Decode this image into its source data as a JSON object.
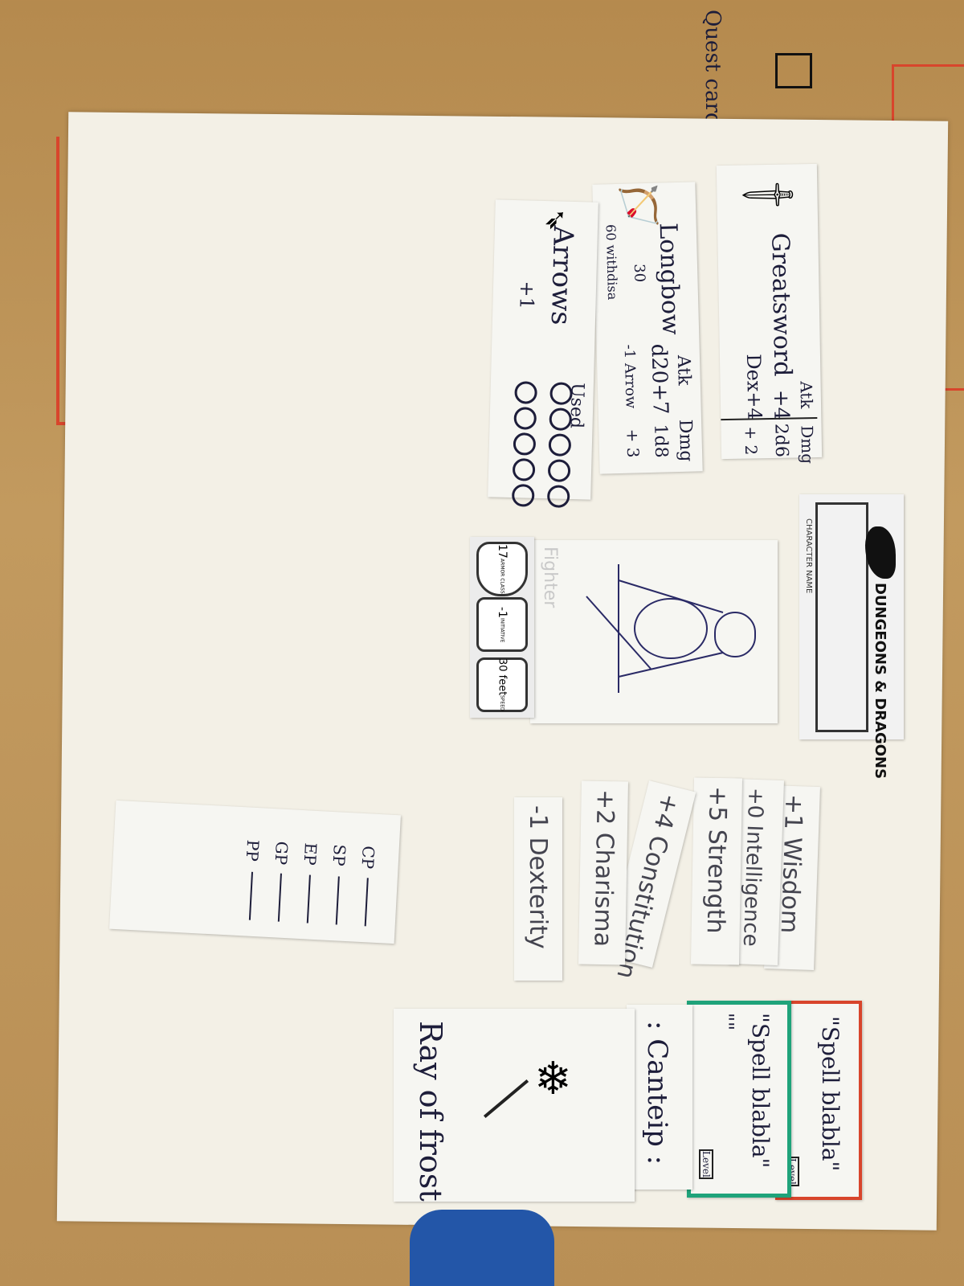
{
  "corner_note": {
    "text": "Quest cards"
  },
  "weapons": [
    {
      "name": "Greatsword",
      "atk_header": "Atk",
      "dmg_header": "Dmg",
      "atk": "+4",
      "atk_note": "Dex+4",
      "dmg": "2d6",
      "dmg_note": "+ 2"
    },
    {
      "name": "Longbow",
      "atk_header": "Atk",
      "dmg_header": "Dmg",
      "atk": "d20+7",
      "atk_note": "-1 Arrow",
      "dmg": "1d8",
      "dmg_note": "+ 3",
      "range": "30",
      "range2": "60 withdisa"
    },
    {
      "name": "Arrows",
      "bonus": "+1",
      "used_label": "Used",
      "used_total": 10
    }
  ],
  "sheet": {
    "logo": "DUNGEONS & DRAGONS",
    "character_name_label": "CHARACTER NAME",
    "class_label": "Fighter",
    "armor_class_value": "17",
    "armor_class_label": "ARMOR CLASS",
    "initiative_value": "-1",
    "initiative_label": "INITIATIVE",
    "speed_value": "30 feet",
    "speed_label": "SPEED"
  },
  "abilities": [
    {
      "text": "+1 Wisdom"
    },
    {
      "text": "+0 Intelligence"
    },
    {
      "text": "+5 Strength"
    },
    {
      "text": "+4 Constitution"
    },
    {
      "text": "+2 Charisma"
    },
    {
      "text": "-1 Dexterity"
    }
  ],
  "coins": [
    {
      "label": "CP"
    },
    {
      "label": "SP"
    },
    {
      "label": "EP"
    },
    {
      "label": "GP"
    },
    {
      "label": "PP"
    }
  ],
  "spells": {
    "card_red": "\"Spell blabla\"",
    "card_red_level": "Level",
    "card_green": "\"Spell blabla\"",
    "card_green_level": "Level",
    "card_green_sub": "\"\"",
    "cantrip": ": Canteip :",
    "ray": "Ray of frost"
  },
  "colors": {
    "red_marker": "#d8452c",
    "green_marker": "#1fa37a",
    "ink": "#1d1d3a"
  }
}
